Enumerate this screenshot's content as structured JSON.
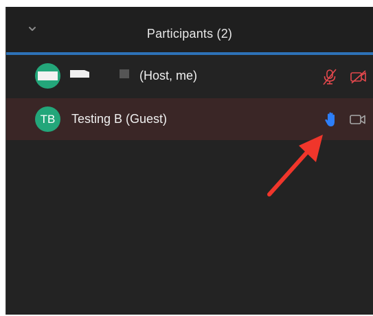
{
  "panel": {
    "title": "Participants (2)",
    "collapse_icon": "chevron-down-icon"
  },
  "participants": [
    {
      "avatar_initials": "",
      "name": "(Host, me)",
      "mic_icon": "mic-muted-icon",
      "video_icon": "video-off-icon",
      "status_color": "#e5484d"
    },
    {
      "avatar_initials": "TB",
      "name": "Testing B (Guest)",
      "hand_icon": "raised-hand-icon",
      "video_icon": "video-icon",
      "hand_color": "#2d7ff9"
    }
  ],
  "colors": {
    "accent": "#2d72b8",
    "avatar": "#23a67a",
    "annotation_arrow": "#f0362b"
  }
}
